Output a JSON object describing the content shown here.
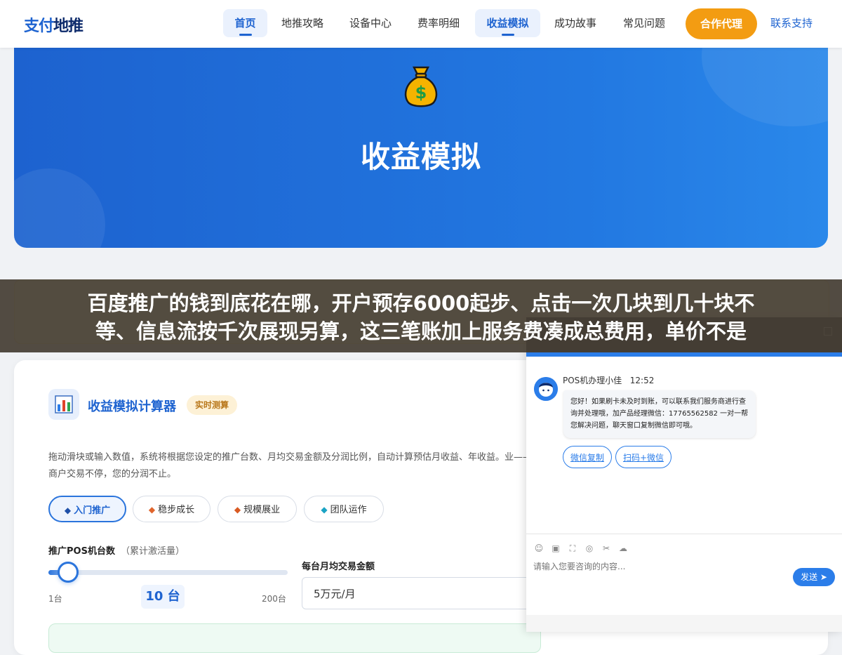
{
  "brand": {
    "name_part1": "支付",
    "name_part2": "地推"
  },
  "nav": {
    "items": [
      {
        "label": "首页"
      },
      {
        "label": "地推攻略"
      },
      {
        "label": "设备中心"
      },
      {
        "label": "费率明细"
      },
      {
        "label": "收益模拟"
      },
      {
        "label": "成功故事"
      },
      {
        "label": "常见问题"
      }
    ],
    "cta_label": "合作代理",
    "contact_label": "联系支持"
  },
  "hero": {
    "icon": "money-bag-icon",
    "title": "收益模拟"
  },
  "overlay": {
    "line1": "百度推广的钱到底花在哪，开户预存6000起步、点击一次几块到几十块不",
    "line2": "等、信息流按千次展现另算，这三笔账加上服务费凑成总费用，单价不是"
  },
  "calculator": {
    "icon": "bar-chart-icon",
    "title": "收益模拟计算器",
    "badge": "实时测算",
    "description": "拖动滑块或输入数值，系统将根据您设定的推广台数、月均交易金额及分润比例，自动计算预估月收益、年收益。业——商户交易不停，您的分润不止。",
    "presets": [
      {
        "label": "入门推广",
        "mark": "◆",
        "color": "#1e4fa8"
      },
      {
        "label": "稳步成长",
        "mark": "◆",
        "color": "#e0652c"
      },
      {
        "label": "规模展业",
        "mark": "◆",
        "color": "#d95a22"
      },
      {
        "label": "团队运作",
        "mark": "◆",
        "color": "#1aa3c4"
      }
    ],
    "pos_label": "推广POS机台数",
    "pos_hint": "（累计激活量）",
    "pos_min": "1台",
    "pos_max": "200台",
    "pos_value": "10 台",
    "pos_fraction": 0.05,
    "monthly_label": "每台月均交易金额",
    "monthly_value": "5万元/月"
  },
  "chat": {
    "agent_name": "POS机办理小佳",
    "time": "12:52",
    "message": "您好！如果刷卡未及时到账，可以联系我们服务商进行查询并处理哦，加产品经理微信：17765562582 一对一帮您解决问题，聊天窗口复制微信即可哦。",
    "links": [
      {
        "label": "微信复制"
      },
      {
        "label": "扫码+微信"
      }
    ],
    "tools": [
      "☺",
      "▣",
      "⛶",
      "◎",
      "✂",
      "☁"
    ],
    "input_placeholder": "请输入您要咨询的内容...",
    "send_label": "发送 ➤"
  }
}
